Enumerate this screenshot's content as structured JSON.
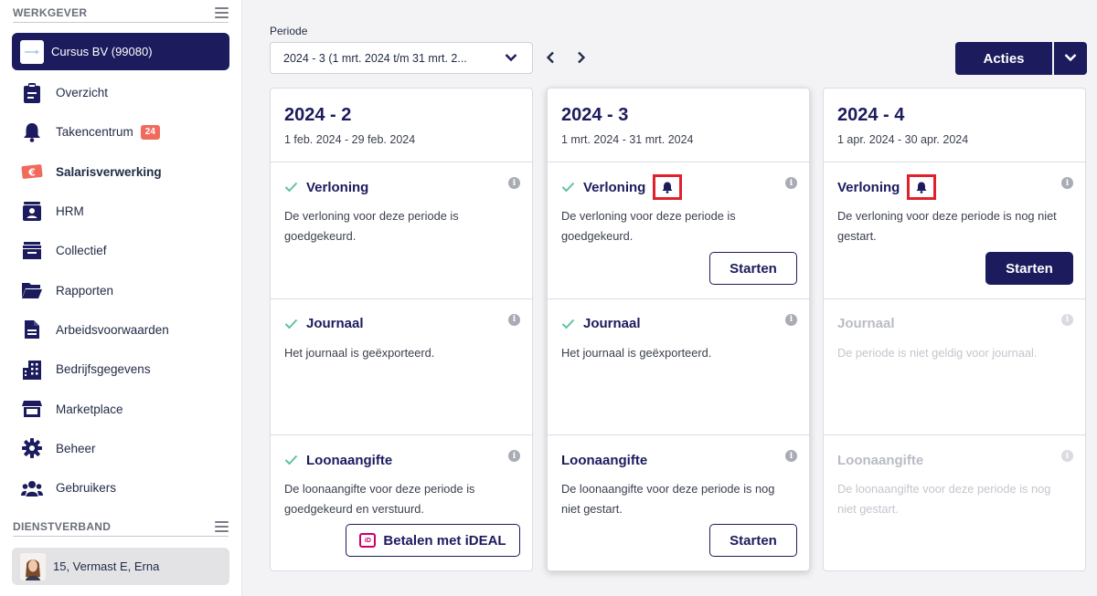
{
  "sidebar": {
    "employer_section": "WERKGEVER",
    "employer_name": "Cursus BV (99080)",
    "items": [
      {
        "label": "Overzicht",
        "icon": "clipboard-icon"
      },
      {
        "label": "Takencentrum",
        "icon": "bell-icon",
        "badge": "24"
      },
      {
        "label": "Salarisverwerking",
        "icon": "euro-banknote-icon",
        "active": true
      },
      {
        "label": "HRM",
        "icon": "id-card-icon"
      },
      {
        "label": "Collectief",
        "icon": "inbox-tray-icon"
      },
      {
        "label": "Rapporten",
        "icon": "folder-icon"
      },
      {
        "label": "Arbeidsvoorwaarden",
        "icon": "document-icon"
      },
      {
        "label": "Bedrijfsgegevens",
        "icon": "building-icon"
      },
      {
        "label": "Marketplace",
        "icon": "store-icon"
      },
      {
        "label": "Beheer",
        "icon": "gear-icon"
      },
      {
        "label": "Gebruikers",
        "icon": "users-icon"
      }
    ],
    "employment_section": "DIENSTVERBAND",
    "employee_name": "15, Vermast E, Erna"
  },
  "toolbar": {
    "periode_label": "Periode",
    "periode_value": "2024 - 3 (1 mrt. 2024 t/m 31 mrt. 2...",
    "acties_label": "Acties"
  },
  "cards": [
    {
      "title": "2024 - 2",
      "dates": "1 feb. 2024 - 29 feb. 2024",
      "steps": [
        {
          "title": "Verloning",
          "desc": "De verloning voor deze periode is goedgekeurd.",
          "status": "done"
        },
        {
          "title": "Journaal",
          "desc": "Het journaal is geëxporteerd.",
          "status": "done"
        },
        {
          "title": "Loonaangifte",
          "desc": "De loonaangifte voor deze periode is goedgekeurd en verstuurd.",
          "status": "done",
          "button": "Betalen met iDEAL"
        }
      ]
    },
    {
      "title": "2024 - 3",
      "dates": "1 mrt. 2024 - 31 mrt. 2024",
      "steps": [
        {
          "title": "Verloning",
          "desc": "De verloning voor deze periode is goedgekeurd.",
          "status": "done",
          "button": "Starten"
        },
        {
          "title": "Journaal",
          "desc": "Het journaal is geëxporteerd.",
          "status": "done"
        },
        {
          "title": "Loonaangifte",
          "desc": "De loonaangifte voor deze periode is nog niet gestart.",
          "status": "todo",
          "button": "Starten"
        }
      ]
    },
    {
      "title": "2024 - 4",
      "dates": "1 apr. 2024 - 30 apr. 2024",
      "steps": [
        {
          "title": "Verloning",
          "desc": "De verloning voor deze periode is nog niet gestart.",
          "status": "todo",
          "button": "Starten"
        },
        {
          "title": "Journaal",
          "desc": "De periode is niet geldig voor journaal.",
          "status": "disabled"
        },
        {
          "title": "Loonaangifte",
          "desc": "De loonaangifte voor deze periode is nog niet gestart.",
          "status": "disabled"
        }
      ]
    }
  ],
  "colors": {
    "primary": "#1b1b5e",
    "check": "#5cc2a0",
    "badge": "#f06b5c",
    "highlight": "#e0212b"
  }
}
